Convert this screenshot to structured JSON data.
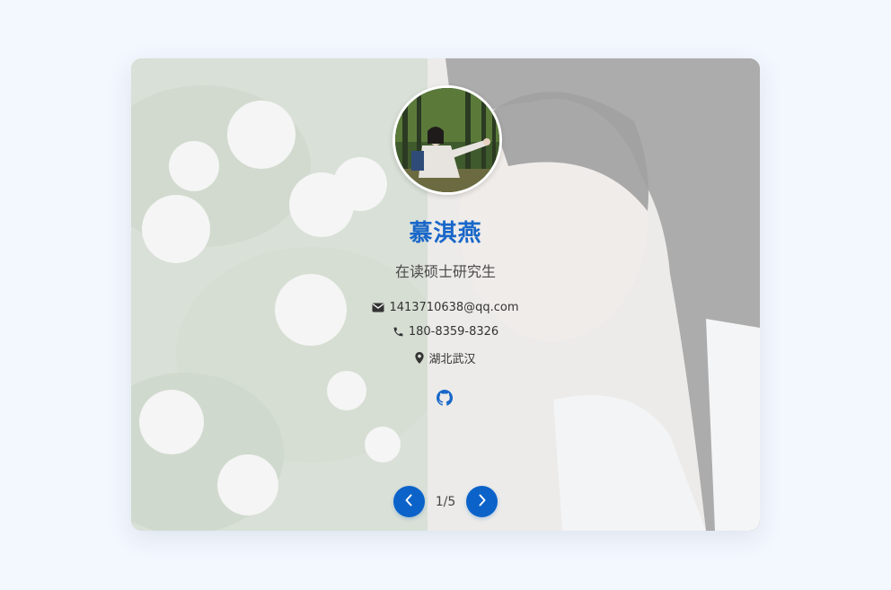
{
  "profile": {
    "name": "慕淇燕",
    "role": "在读硕士研究生",
    "email": "1413710638@qq.com",
    "phone": "180-8359-8326",
    "location": "湖北武汉"
  },
  "links": {
    "github_icon": "github-icon"
  },
  "pager": {
    "indicator": "1/5",
    "prev_icon": "chevron-left-icon",
    "next_icon": "chevron-right-icon"
  },
  "colors": {
    "accent": "#0b63c9",
    "name_color": "#1967c9",
    "page_bg": "#f3f7fe"
  }
}
